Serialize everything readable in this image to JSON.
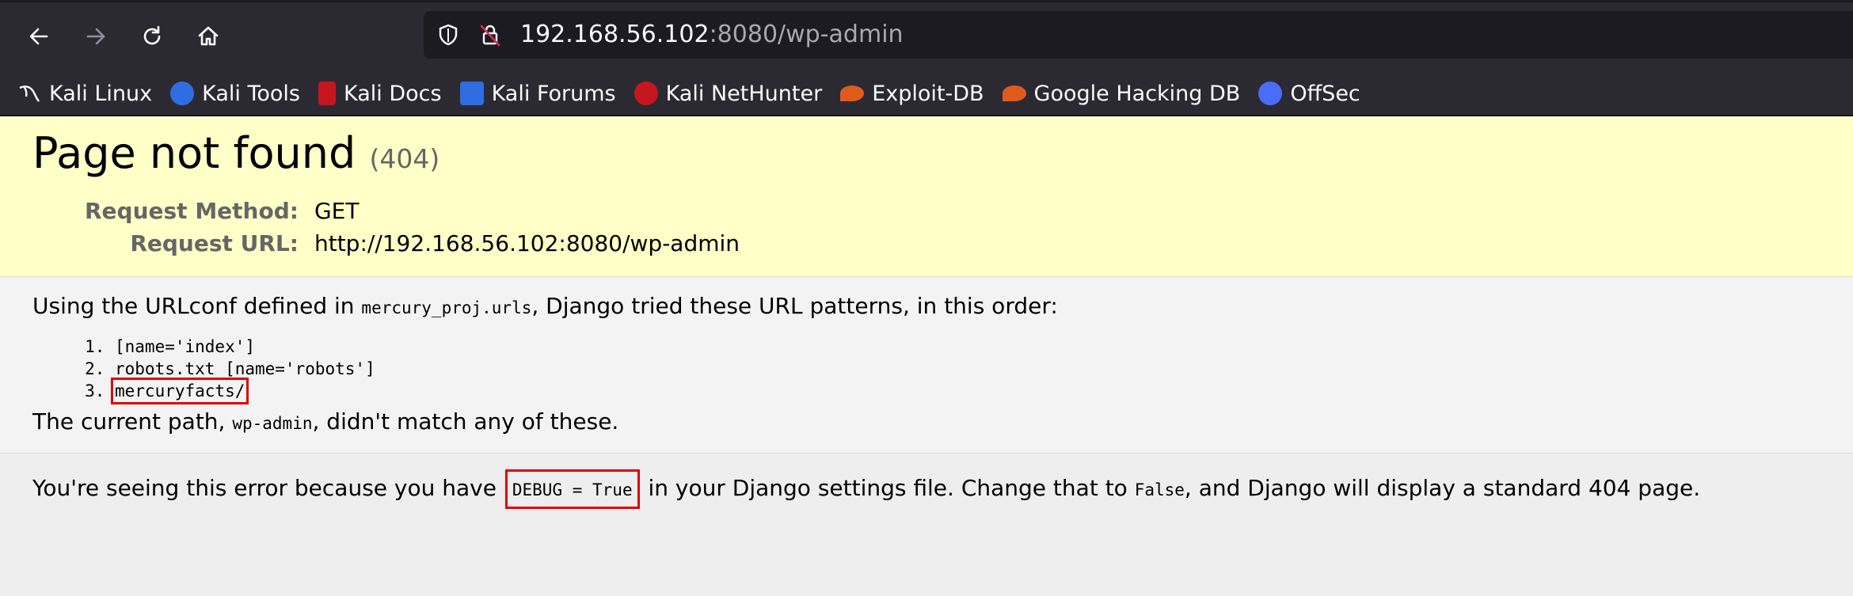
{
  "browser": {
    "url_host": "192.168.56.102",
    "url_path": ":8080/wp-admin",
    "bookmarks": [
      {
        "label": "Kali Linux",
        "color": "#367bf0"
      },
      {
        "label": "Kali Tools",
        "color": "#2f6de1"
      },
      {
        "label": "Kali Docs",
        "color": "#c4161c"
      },
      {
        "label": "Kali Forums",
        "color": "#2f6de1"
      },
      {
        "label": "Kali NetHunter",
        "color": "#c4161c"
      },
      {
        "label": "Exploit-DB",
        "color": "#e05a1d"
      },
      {
        "label": "Google Hacking DB",
        "color": "#e05a1d"
      },
      {
        "label": "OffSec",
        "color": "#4a6cf7"
      }
    ]
  },
  "page": {
    "title": "Page not found",
    "status_code": "(404)",
    "request_method_label": "Request Method:",
    "request_method": "GET",
    "request_url_label": "Request URL:",
    "request_url": "http://192.168.56.102:8080/wp-admin",
    "urlconf_pre": "Using the URLconf defined in ",
    "urlconf_name": "mercury_proj.urls",
    "urlconf_post": ", Django tried these URL patterns, in this order:",
    "patterns": [
      "[name='index']",
      "robots.txt [name='robots']",
      "mercuryfacts/"
    ],
    "current_path_pre": "The current path, ",
    "current_path": "wp-admin",
    "current_path_post": ", didn't match any of these.",
    "explain_pre": "You're seeing this error because you have ",
    "debug_setting": "DEBUG = True",
    "explain_mid": " in your Django settings file. Change that to ",
    "false_value": "False",
    "explain_post": ", and Django will display a standard 404 page."
  }
}
